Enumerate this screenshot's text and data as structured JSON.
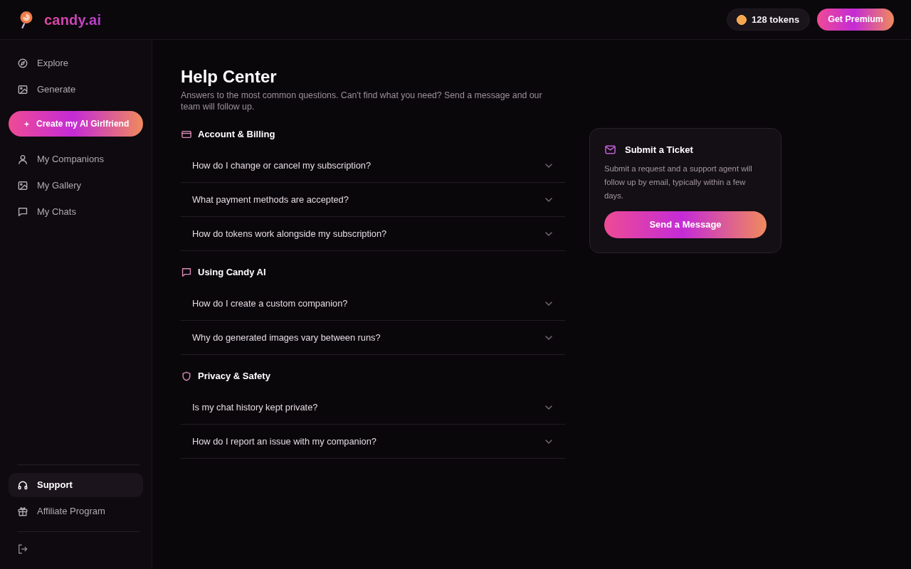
{
  "header": {
    "brand": "candy.ai",
    "tokens": "128 tokens",
    "premium_button": "Get Premium"
  },
  "sidebar": {
    "items": [
      {
        "label": "Explore",
        "kind": "link",
        "selected": false
      },
      {
        "label": "Generate",
        "kind": "link",
        "selected": false
      },
      {
        "label": "Create my AI Girlfriend",
        "kind": "cta",
        "selected": false
      },
      {
        "label": "My Companions",
        "kind": "link",
        "selected": false
      },
      {
        "label": "My Gallery",
        "kind": "link",
        "selected": false
      },
      {
        "label": "My Chats",
        "kind": "link",
        "selected": false
      }
    ],
    "bottom_items": [
      {
        "label": "Support",
        "selected": true
      },
      {
        "label": "Affiliate Program",
        "selected": false
      }
    ]
  },
  "page": {
    "title": "Help Center",
    "subtitle": "Answers to the most common questions. Can't find what you need? Send a message and our team will follow up."
  },
  "sections": [
    {
      "title": "Account & Billing",
      "questions": [
        {
          "text": "How do I change or cancel my subscription?",
          "expanded": false
        },
        {
          "text": "What payment methods are accepted?",
          "expanded": false
        },
        {
          "text": "How do tokens work alongside my subscription?",
          "expanded": false
        }
      ]
    },
    {
      "title": "Using Candy AI",
      "questions": [
        {
          "text": "How do I create a custom companion?",
          "expanded": false
        },
        {
          "text": "Why do generated images vary between runs?",
          "expanded": false
        }
      ]
    },
    {
      "title": "Privacy & Safety",
      "questions": [
        {
          "text": "Is my chat history kept private?",
          "expanded": false
        },
        {
          "text": "How do I report an issue with my companion?",
          "expanded": false
        }
      ]
    }
  ],
  "ticket_card": {
    "title": "Submit a Ticket",
    "text": "Submit a request and a support agent will follow up by email, typically within a few days.",
    "button": "Send a Message"
  }
}
